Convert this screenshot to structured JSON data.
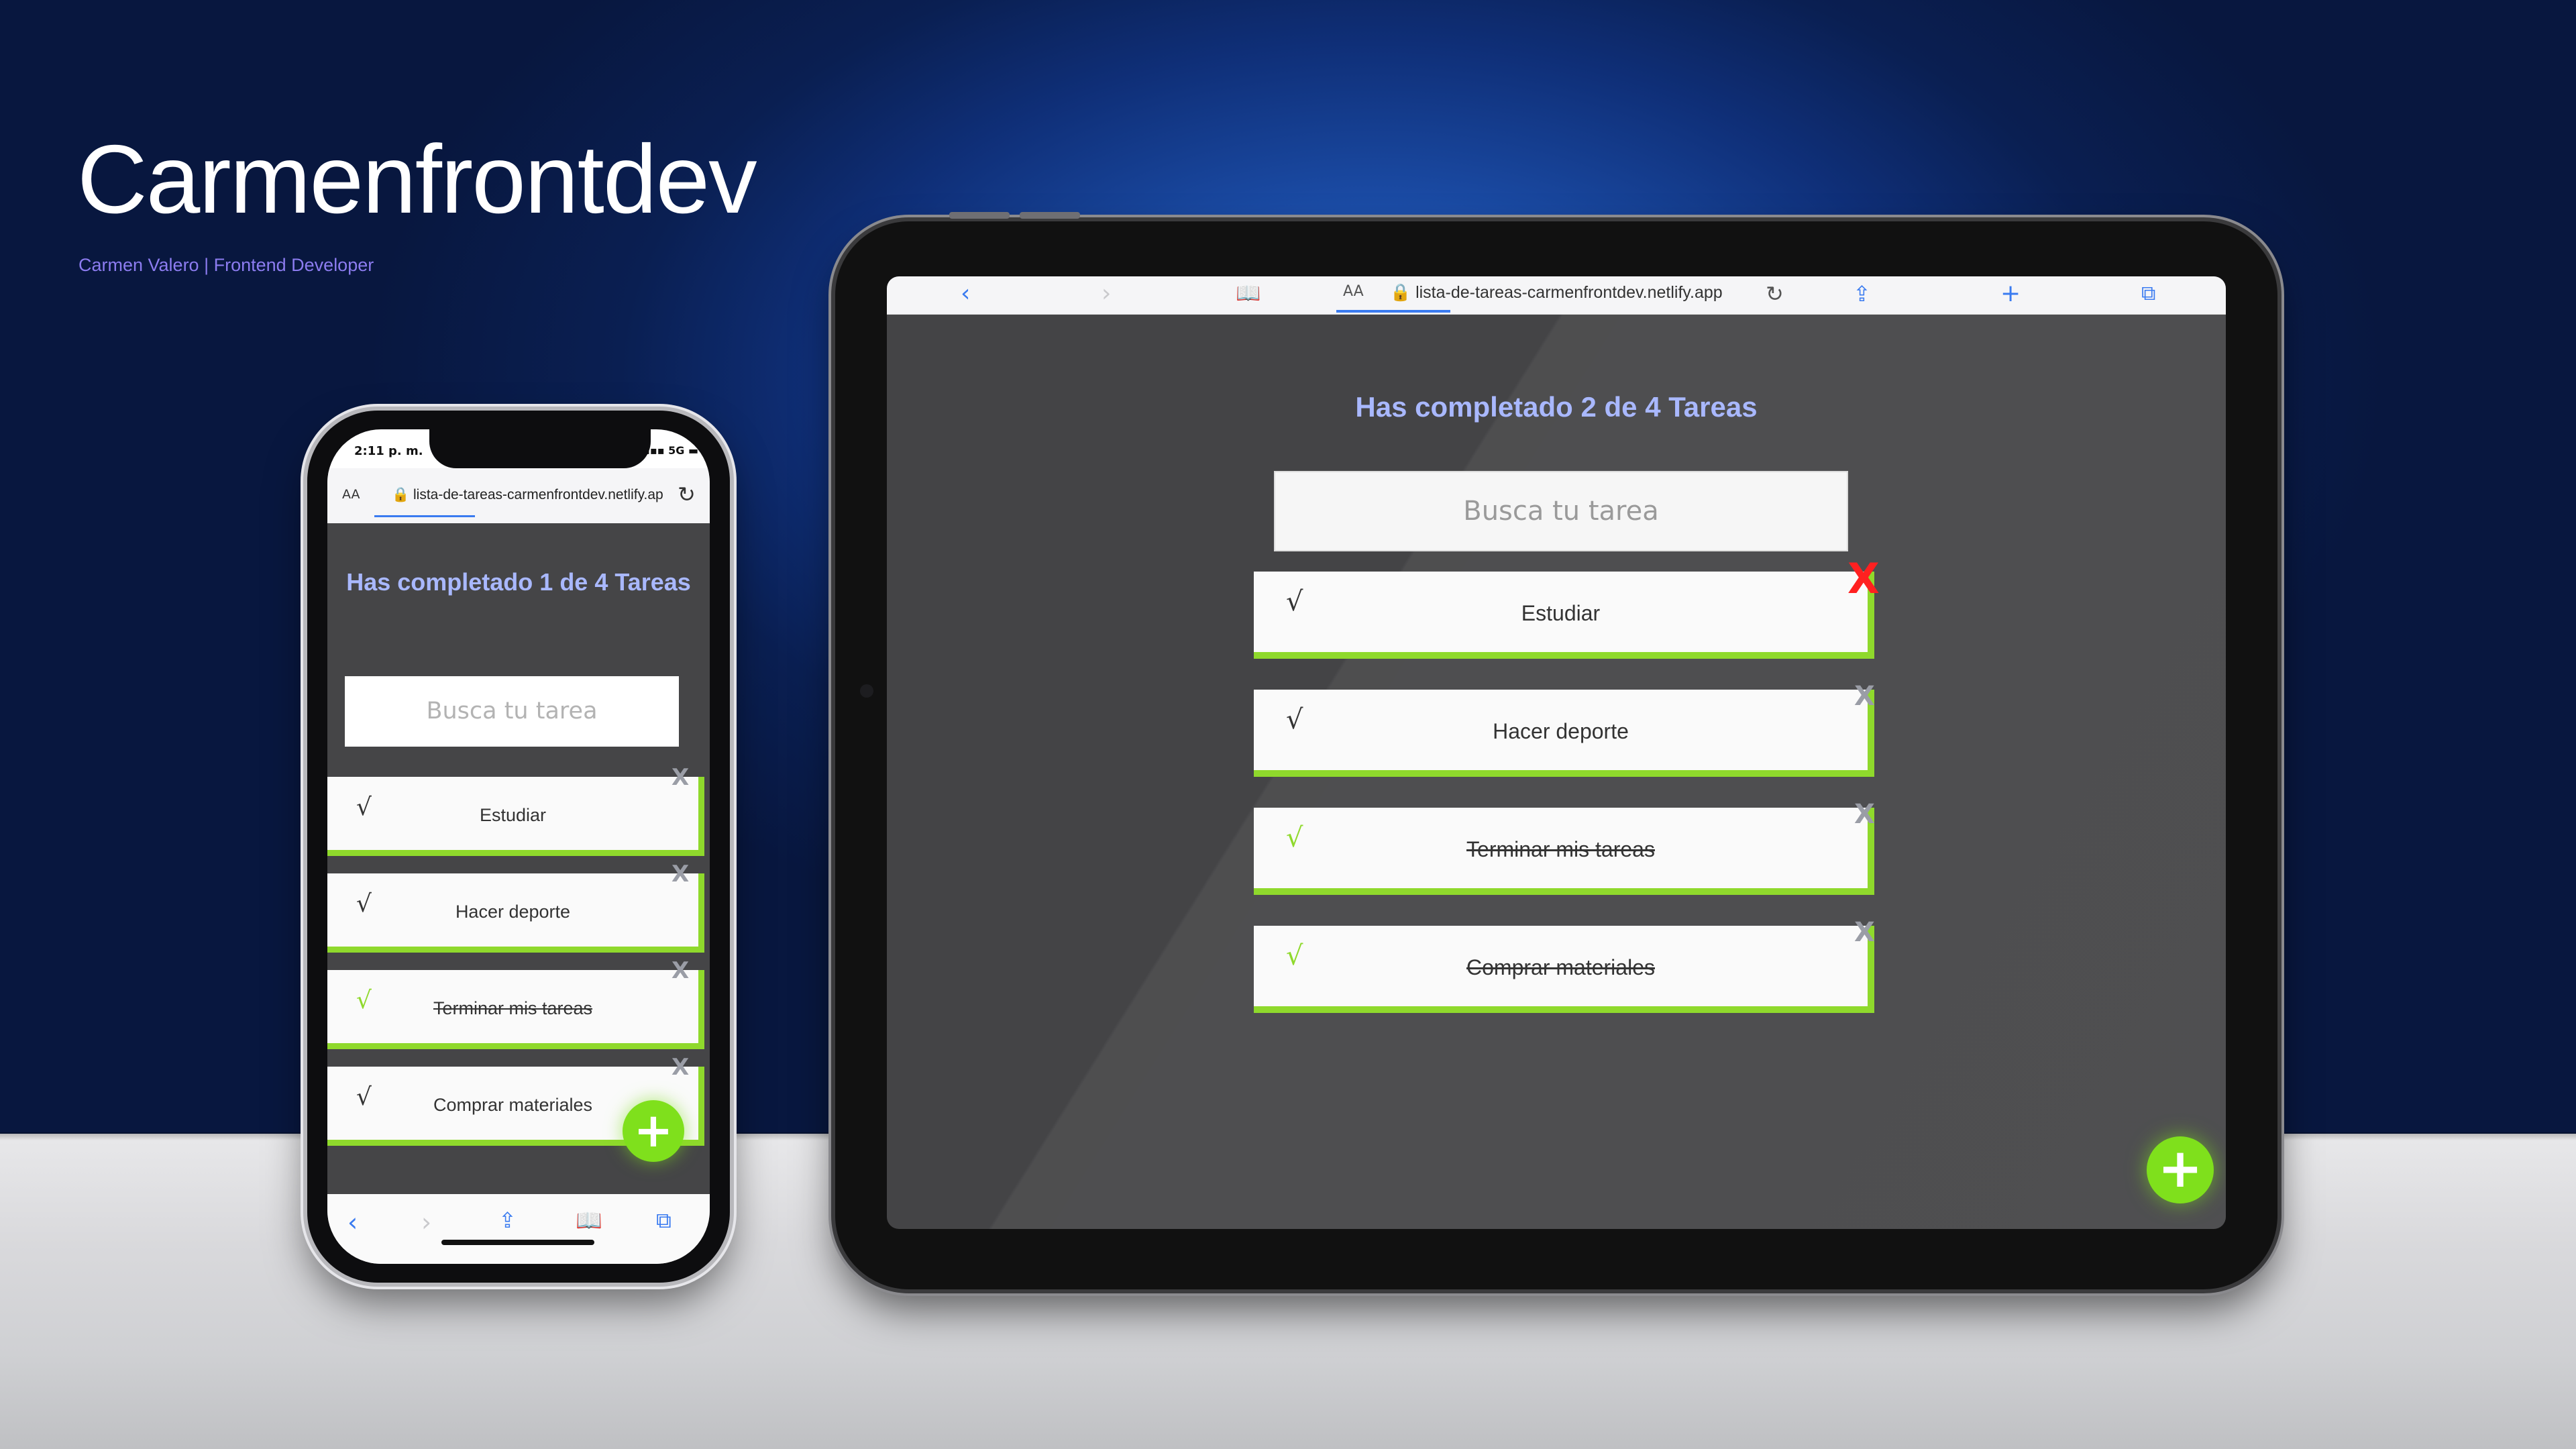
{
  "brand": {
    "title": "Carmenfrontdev",
    "subtitle": "Carmen Valero | Frontend Developer"
  },
  "colors": {
    "accent_green": "#8fd92c",
    "title_blue": "#a9b8ff",
    "delete_red": "#ff2020",
    "browser_blue": "#3a7bf0"
  },
  "tablet": {
    "browser": {
      "aa_label": "AA",
      "url": "lista-de-tareas-carmenfrontdev.netlify.app",
      "icons": [
        "back-icon",
        "forward-icon",
        "bookmarks-icon",
        "lock-icon",
        "reload-icon",
        "share-icon",
        "new-tab-icon",
        "tabs-icon"
      ]
    },
    "counter_title": "Has completado 2 de 4 Tareas",
    "search_placeholder": "Busca tu tarea",
    "check_symbol": "√",
    "delete_symbol": "X",
    "todos": [
      {
        "text": "Estudiar",
        "completed": false
      },
      {
        "text": "Hacer deporte",
        "completed": false
      },
      {
        "text": "Terminar mis tareas",
        "completed": true
      },
      {
        "text": "Comprar materiales",
        "completed": true
      }
    ],
    "add_button": "+"
  },
  "phone": {
    "status": {
      "time": "2:11 p. m.",
      "network": "5G"
    },
    "browser": {
      "aa_label": "AA",
      "url": "lista-de-tareas-carmenfrontdev.netlify.ap"
    },
    "counter_title": "Has completado 1 de 4 Tareas",
    "search_placeholder": "Busca tu tarea",
    "check_symbol": "√",
    "delete_symbol": "X",
    "todos": [
      {
        "text": "Estudiar",
        "completed": false
      },
      {
        "text": "Hacer deporte",
        "completed": false
      },
      {
        "text": "Terminar mis tareas",
        "completed": true
      },
      {
        "text": "Comprar materiales",
        "completed": false
      }
    ],
    "add_button": "+"
  }
}
